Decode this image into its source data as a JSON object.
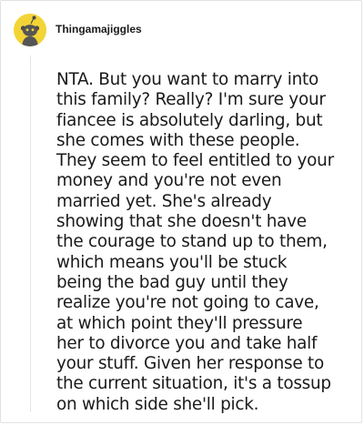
{
  "comment": {
    "author": "Thingamajiggles",
    "avatar_icon": "snoo-avatar-icon",
    "avatar_color": "#f3d437",
    "body": "NTA. But you want to marry into\nthis family? Really? I'm sure your\nfiancee is absolutely darling, but\nshe comes with these people.\nThey seem to feel entitled to your\nmoney and you're not even\nmarried yet. She's already\nshowing that she doesn't have\nthe courage to stand up to them,\nwhich means you'll be stuck\nbeing the bad guy until they\nrealize you're not going to cave,\nat which point they'll pressure\nher to divorce you and take half\nyour stuff. Given her response to\nthe current situation, it's a tossup\non which side she'll pick."
  }
}
